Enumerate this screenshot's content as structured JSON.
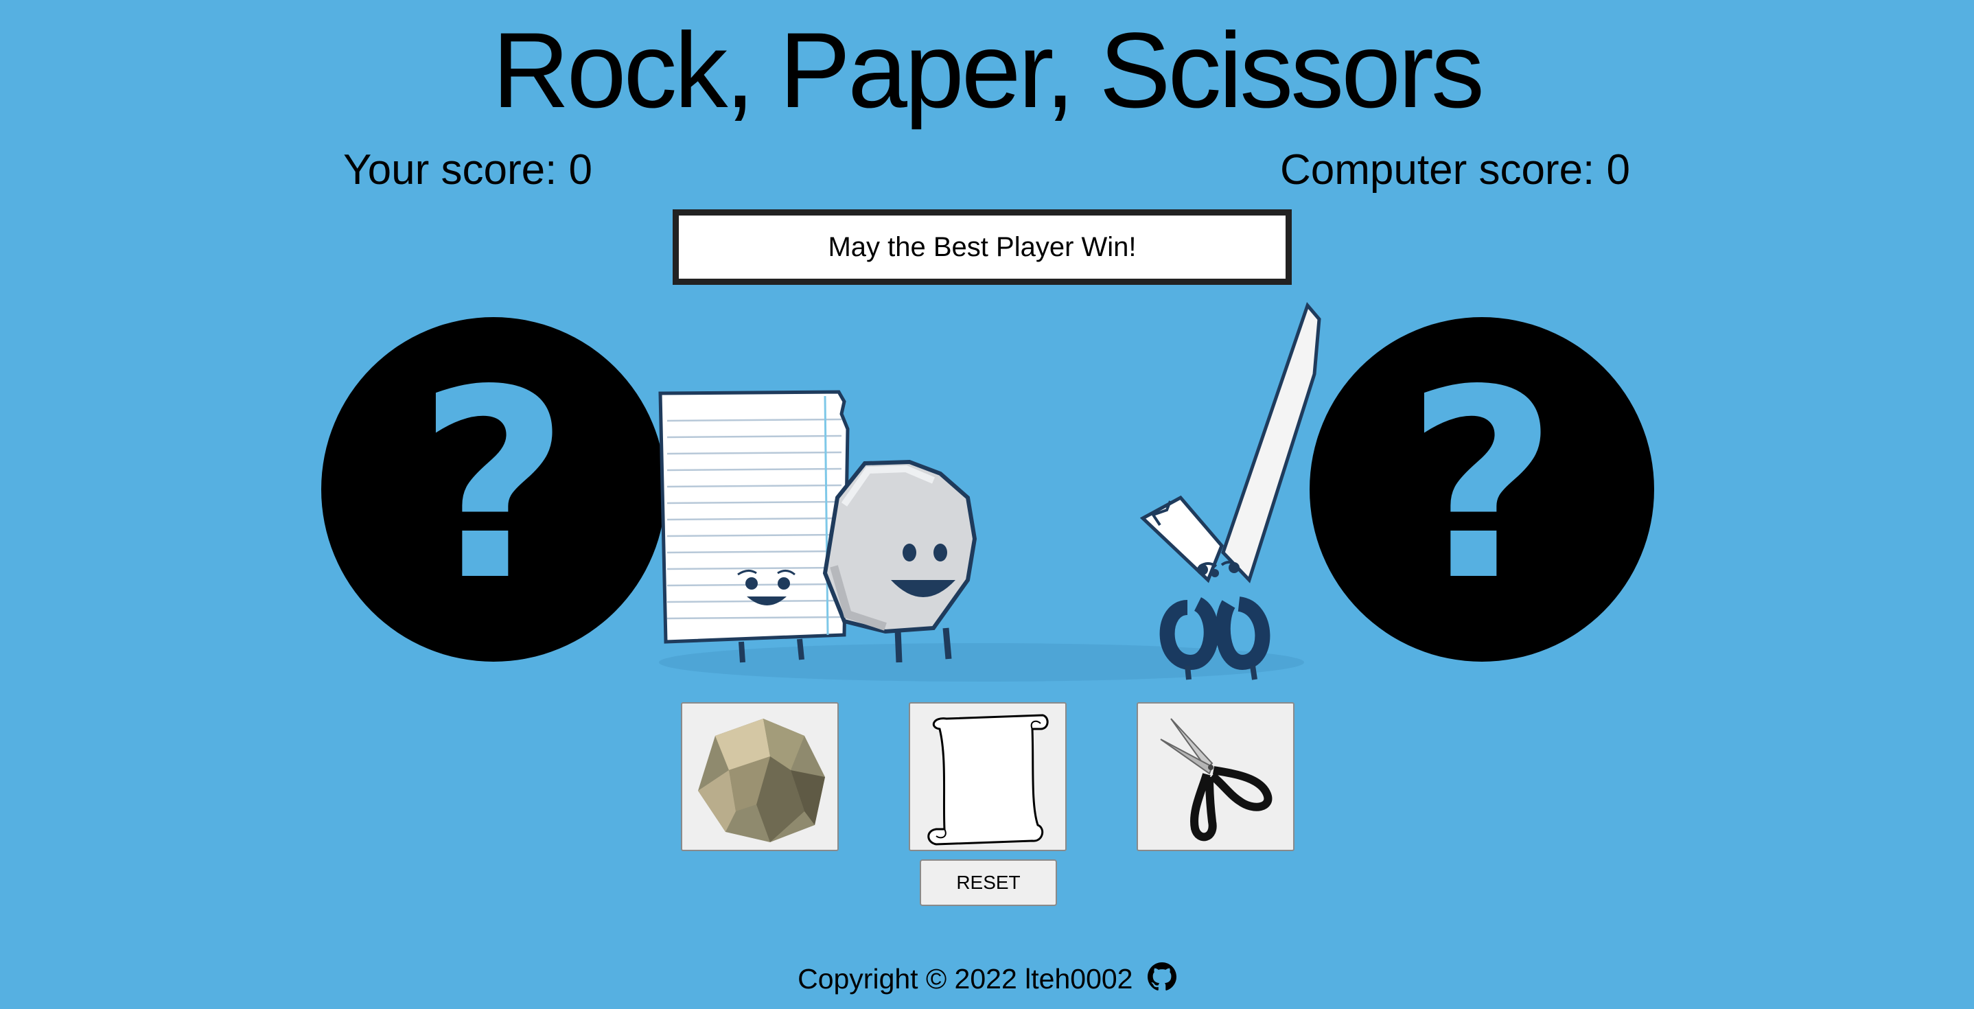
{
  "header": {
    "title": "Rock, Paper, Scissors"
  },
  "scores": {
    "player": "Your score: 0",
    "computer": "Computer score: 0"
  },
  "message": "May the Best Player Win!",
  "choices": {
    "player_display": "?",
    "computer_display": "?"
  },
  "buttons": [
    {
      "name": "rock",
      "icon": "rock-icon"
    },
    {
      "name": "paper",
      "icon": "paper-scroll-icon"
    },
    {
      "name": "scissors",
      "icon": "scissors-icon"
    }
  ],
  "reset_label": "RESET",
  "footer": {
    "copyright": "Copyright © 2022 lteh0002",
    "icon": "github-icon"
  },
  "colors": {
    "background": "#56b0e1",
    "circle": "#000000",
    "message_border": "#222222"
  }
}
